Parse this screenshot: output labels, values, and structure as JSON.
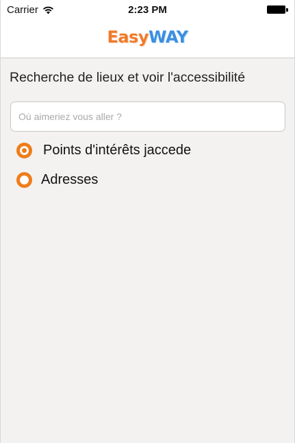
{
  "status_bar": {
    "carrier": "Carrier",
    "time": "2:23 PM"
  },
  "nav_bar": {
    "logo_part1": "Easy",
    "logo_part2": "WAY"
  },
  "main": {
    "title": "Recherche de lieux et voir l'accessibilité",
    "search": {
      "placeholder": "Où aimeriez vous aller ?",
      "value": ""
    },
    "options": [
      {
        "label": "Points d'intérêts jaccede",
        "selected": true
      },
      {
        "label": "Adresses",
        "selected": false
      }
    ]
  },
  "colors": {
    "accent": "#ef7d1a",
    "logo_easy": "#f07a2c",
    "logo_way": "#3b8fe0",
    "background": "#f3f2f0"
  },
  "icons": [
    "wifi-icon",
    "battery-icon",
    "radio-selected-icon",
    "radio-unselected-icon"
  ]
}
